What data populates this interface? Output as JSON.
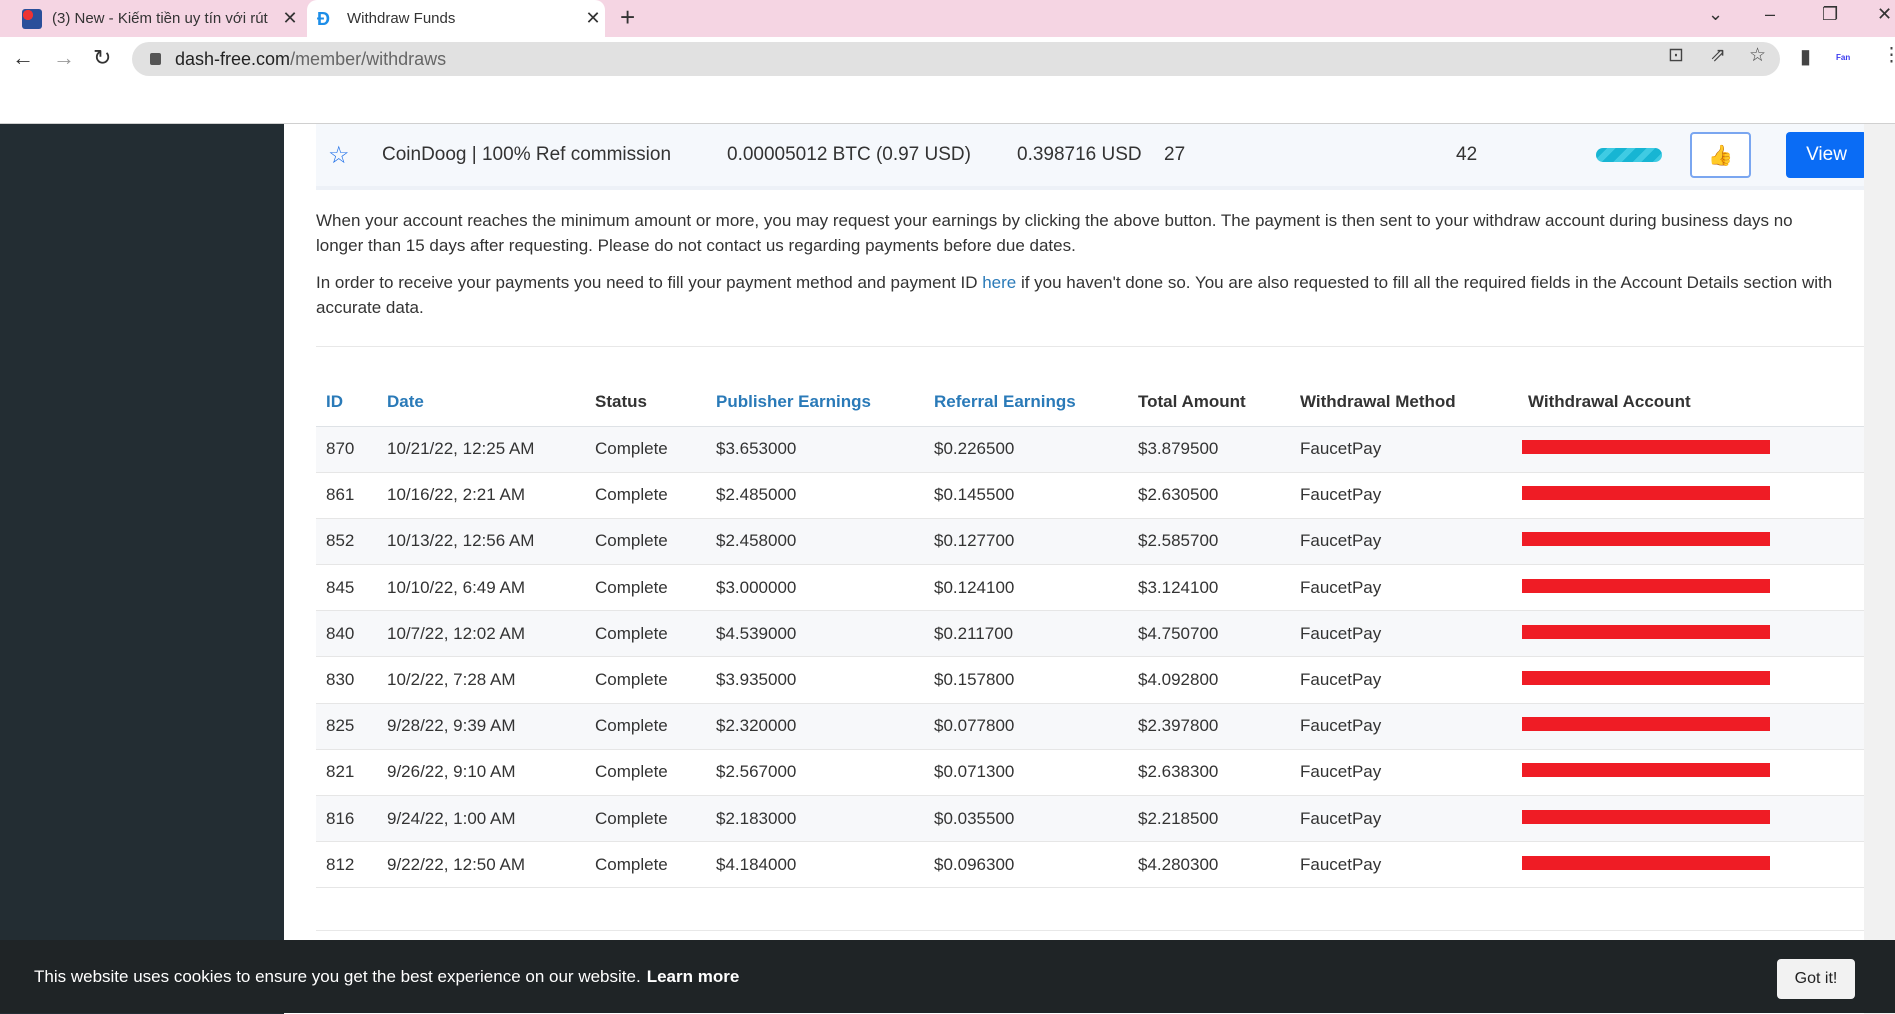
{
  "browser": {
    "tabs": [
      {
        "title": "(3) New - Kiếm tiền uy tín với rút",
        "active": false
      },
      {
        "title": "Withdraw Funds",
        "active": true
      }
    ],
    "url_domain": "dash-free.com",
    "url_path": "/member/withdraws",
    "extension_label": "Fan"
  },
  "featured": {
    "name": "CoinDoog | 100% Ref commission",
    "amount": "0.00005012 BTC (0.97 USD)",
    "usd": "0.398716 USD",
    "count1": "27",
    "count2": "42",
    "progress": 0.8,
    "view_label": "View"
  },
  "info": {
    "p1": "When your account reaches the minimum amount or more, you may request your earnings by clicking the above button. The payment is then sent to your withdraw account during business days no longer than 15 days after requesting. Please do not contact us regarding payments before due dates.",
    "p2_before": "In order to receive your payments you need to fill your payment method and payment ID ",
    "p2_link": "here",
    "p2_after": " if you haven't done so. You are also requested to fill all the required fields in the Account Details section with accurate data."
  },
  "table": {
    "headers": [
      "ID",
      "Date",
      "Status",
      "Publisher Earnings",
      "Referral Earnings",
      "Total Amount",
      "Withdrawal Method",
      "Withdrawal Account"
    ],
    "rows": [
      [
        "870",
        "10/21/22, 12:25 AM",
        "Complete",
        "$3.653000",
        "$0.226500",
        "$3.879500",
        "FaucetPay"
      ],
      [
        "861",
        "10/16/22, 2:21 AM",
        "Complete",
        "$2.485000",
        "$0.145500",
        "$2.630500",
        "FaucetPay"
      ],
      [
        "852",
        "10/13/22, 12:56 AM",
        "Complete",
        "$2.458000",
        "$0.127700",
        "$2.585700",
        "FaucetPay"
      ],
      [
        "845",
        "10/10/22, 6:49 AM",
        "Complete",
        "$3.000000",
        "$0.124100",
        "$3.124100",
        "FaucetPay"
      ],
      [
        "840",
        "10/7/22, 12:02 AM",
        "Complete",
        "$4.539000",
        "$0.211700",
        "$4.750700",
        "FaucetPay"
      ],
      [
        "830",
        "10/2/22, 7:28 AM",
        "Complete",
        "$3.935000",
        "$0.157800",
        "$4.092800",
        "FaucetPay"
      ],
      [
        "825",
        "9/28/22, 9:39 AM",
        "Complete",
        "$2.320000",
        "$0.077800",
        "$2.397800",
        "FaucetPay"
      ],
      [
        "821",
        "9/26/22, 9:10 AM",
        "Complete",
        "$2.567000",
        "$0.071300",
        "$2.638300",
        "FaucetPay"
      ],
      [
        "816",
        "9/24/22, 1:00 AM",
        "Complete",
        "$2.183000",
        "$0.035500",
        "$2.218500",
        "FaucetPay"
      ],
      [
        "812",
        "9/22/22, 12:50 AM",
        "Complete",
        "$4.184000",
        "$0.096300",
        "$4.280300",
        "FaucetPay"
      ]
    ]
  },
  "cookie": {
    "message": "This website uses cookies to ensure you get the best experience on our website.",
    "learn_more": "Learn more",
    "button": "Got it!"
  },
  "colors": {
    "accent": "#0a6cf5",
    "link": "#2a7ab8",
    "redaction": "#ef1c25",
    "sidebar": "#232d33"
  }
}
